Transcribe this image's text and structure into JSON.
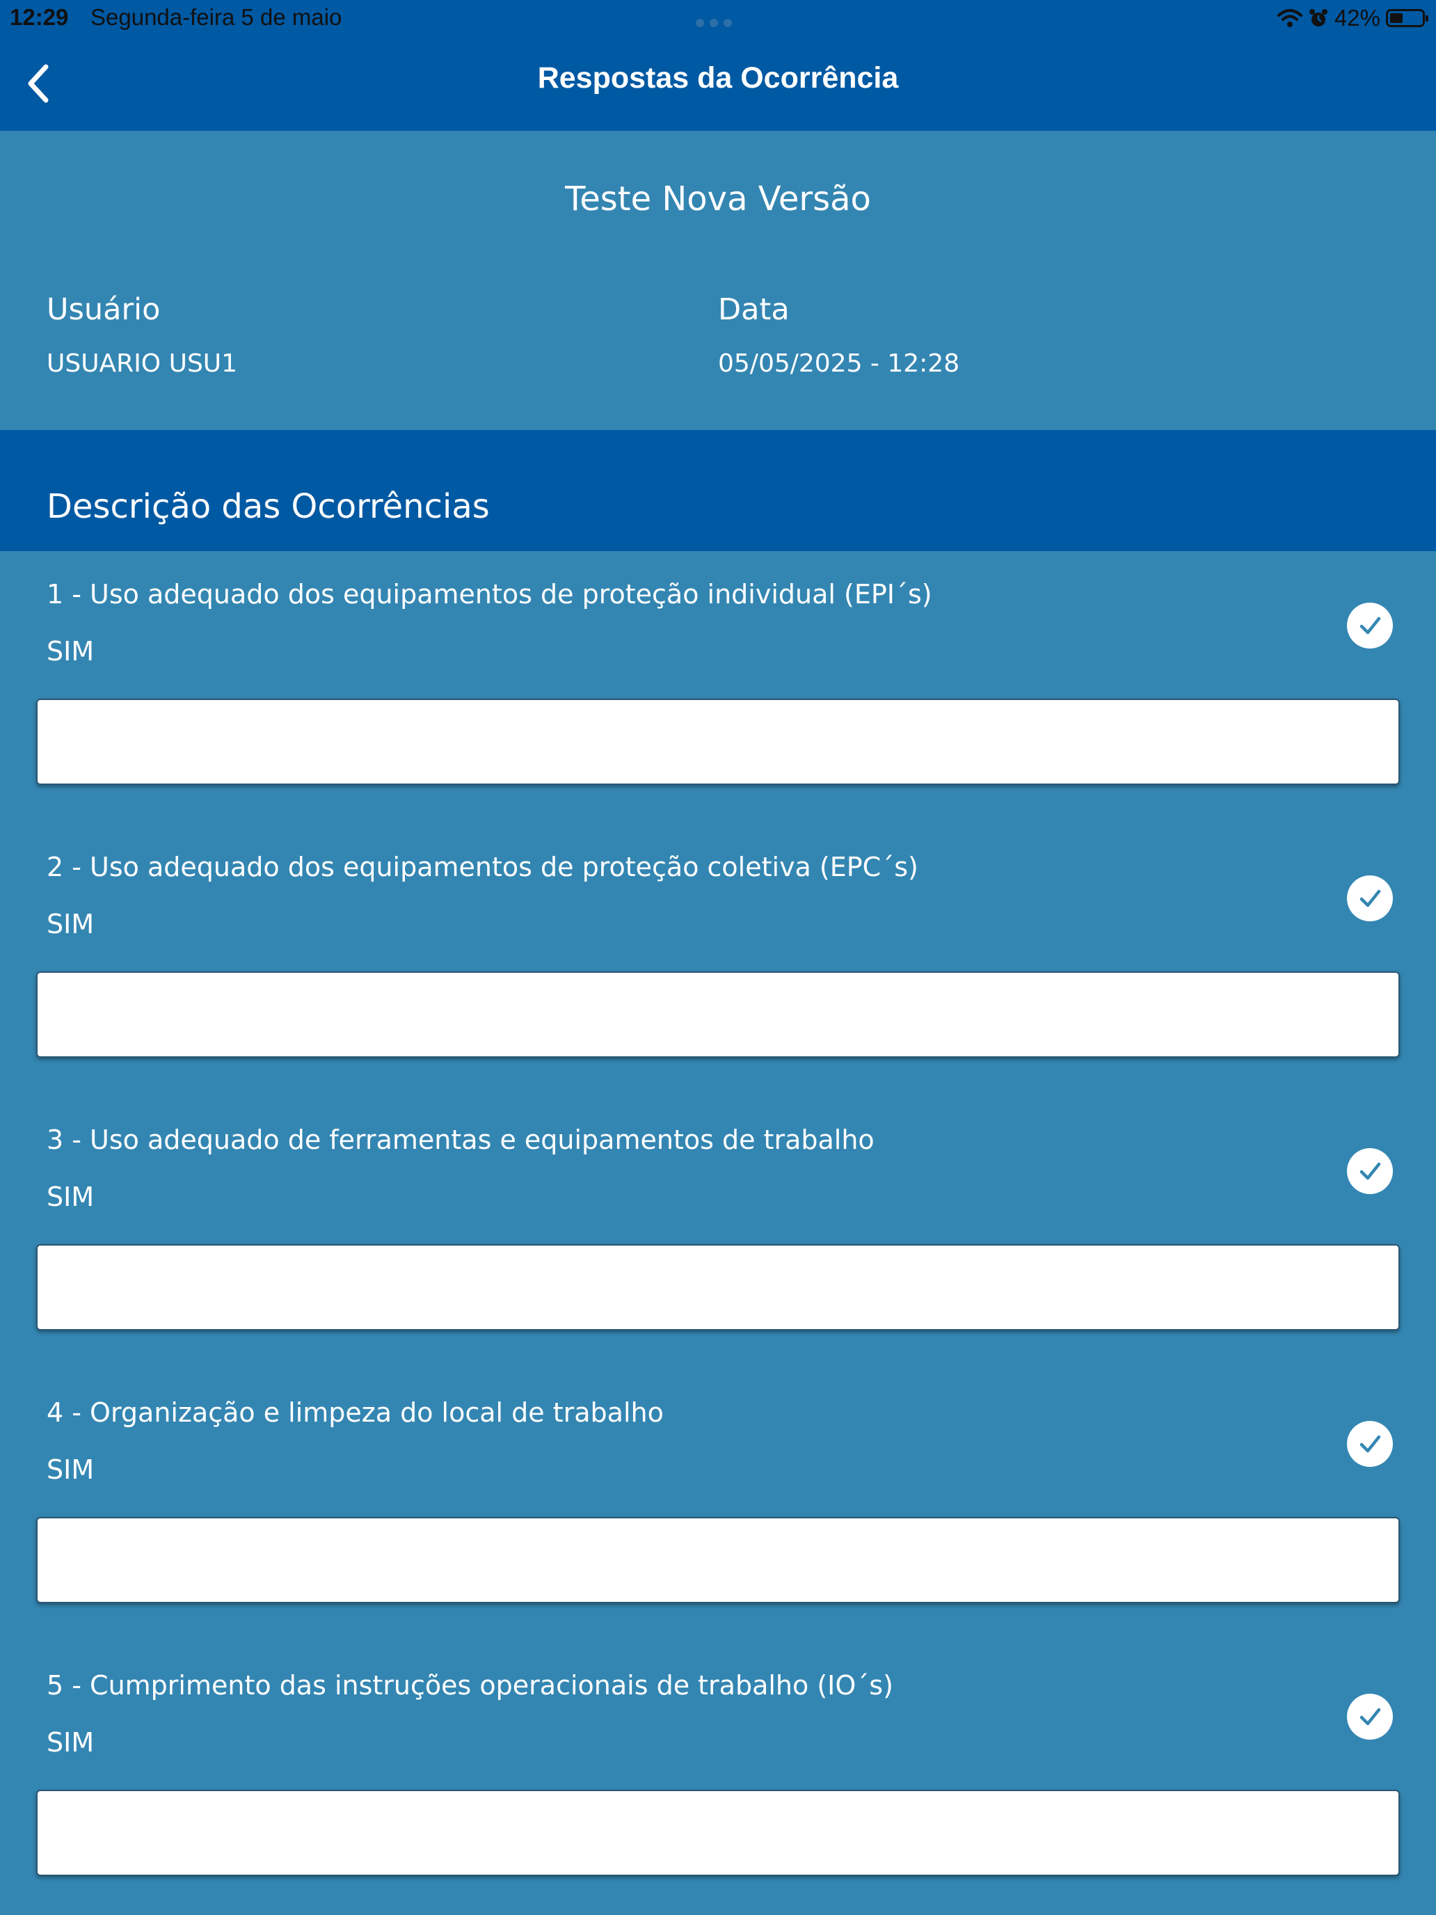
{
  "status_bar": {
    "time": "12:29",
    "date": "Segunda-feira 5 de maio",
    "battery_percent": "42%",
    "battery_level": 0.42
  },
  "nav": {
    "title": "Respostas da Ocorrência"
  },
  "header": {
    "doc_title": "Teste Nova Versão",
    "user_label": "Usuário",
    "user_value": "USUARIO USU1",
    "date_label": "Data",
    "date_value": "05/05/2025 - 12:28"
  },
  "section": {
    "title": "Descrição das Ocorrências"
  },
  "questions": [
    {
      "label": "1 - Uso adequado dos equipamentos de proteção individual (EPI´s)",
      "answer": "SIM",
      "comment": ""
    },
    {
      "label": "2 - Uso adequado dos equipamentos de proteção coletiva (EPC´s)",
      "answer": "SIM",
      "comment": ""
    },
    {
      "label": "3 - Uso adequado de ferramentas e equipamentos de trabalho",
      "answer": "SIM",
      "comment": ""
    },
    {
      "label": "4 - Organização e limpeza do local de trabalho",
      "answer": "SIM",
      "comment": ""
    },
    {
      "label": "5 - Cumprimento das instruções operacionais de trabalho (IO´s)",
      "answer": "SIM",
      "comment": ""
    }
  ],
  "colors": {
    "nav_background": "#0059a3",
    "content_background": "#3486b2",
    "check_mark": "#3486b2"
  },
  "icons": {
    "back": "chevron-left-icon",
    "check": "check-circle-icon",
    "wifi": "wifi-icon",
    "alarm": "alarm-icon",
    "battery": "battery-icon"
  }
}
